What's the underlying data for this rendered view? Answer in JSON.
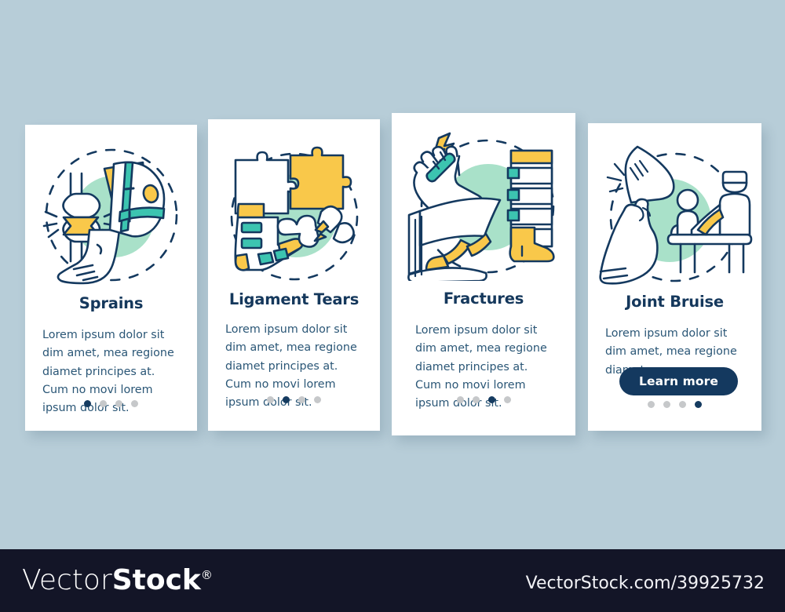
{
  "page": {
    "background_color": "#b7cdd8",
    "palette": {
      "navy": "#14395f",
      "mint": "#a9e1c9",
      "yellow": "#f9c84a",
      "teal": "#3cc4b0",
      "body_text": "#2a5676",
      "dot_inactive": "#c6c8ca",
      "card_bg": "#ffffff"
    }
  },
  "cards": [
    {
      "title": "Sprains",
      "body": "Lorem ipsum dolor sit dim amet, mea regione diamet principes at. Cum no movi lorem ipsum dolor sit.",
      "illustration": "sprained-knee-brace-icon",
      "dots": {
        "count": 4,
        "active_index": 0
      },
      "button": null
    },
    {
      "title": "Ligament Tears",
      "body": "Lorem ipsum dolor sit dim amet, mea regione diamet principes at. Cum no movi lorem ipsum dolor sit.",
      "illustration": "torn-ligament-puzzle-icon",
      "dots": {
        "count": 4,
        "active_index": 1
      },
      "button": null
    },
    {
      "title": "Fractures",
      "body": "Lorem ipsum dolor sit dim amet, mea regione diamet principes at. Cum no movi lorem ipsum dolor sit.",
      "illustration": "broken-bone-cast-icon",
      "dots": {
        "count": 4,
        "active_index": 2
      },
      "button": null
    },
    {
      "title": "Joint Bruise",
      "body": "Lorem ipsum dolor sit dim amet, mea regione diamet.",
      "illustration": "bruised-arm-therapy-icon",
      "dots": {
        "count": 4,
        "active_index": 3
      },
      "button": {
        "label": "Learn more"
      }
    }
  ],
  "footer": {
    "logo_thin": "Vector",
    "logo_bold": "Stock",
    "logo_registered": "®",
    "site_url": "VectorStock.com/39925732",
    "background_color": "#131527"
  }
}
